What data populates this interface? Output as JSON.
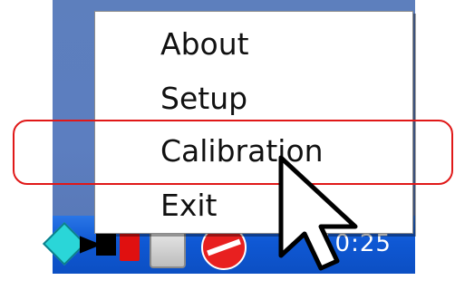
{
  "menu": {
    "items": [
      {
        "label": "About"
      },
      {
        "label": "Setup"
      },
      {
        "label": "Calibration"
      },
      {
        "label": "Exit"
      }
    ]
  },
  "taskbar": {
    "clock": "10:25",
    "tray_icons": [
      "cyan-diamond-icon",
      "plug-icon",
      "red-block-icon",
      "gray-device-icon",
      "no-entry-icon"
    ]
  },
  "colors": {
    "taskbar_blue": "#0f58d4",
    "highlight_red": "#e01818",
    "desktop_blue": "#5c7ec0"
  }
}
